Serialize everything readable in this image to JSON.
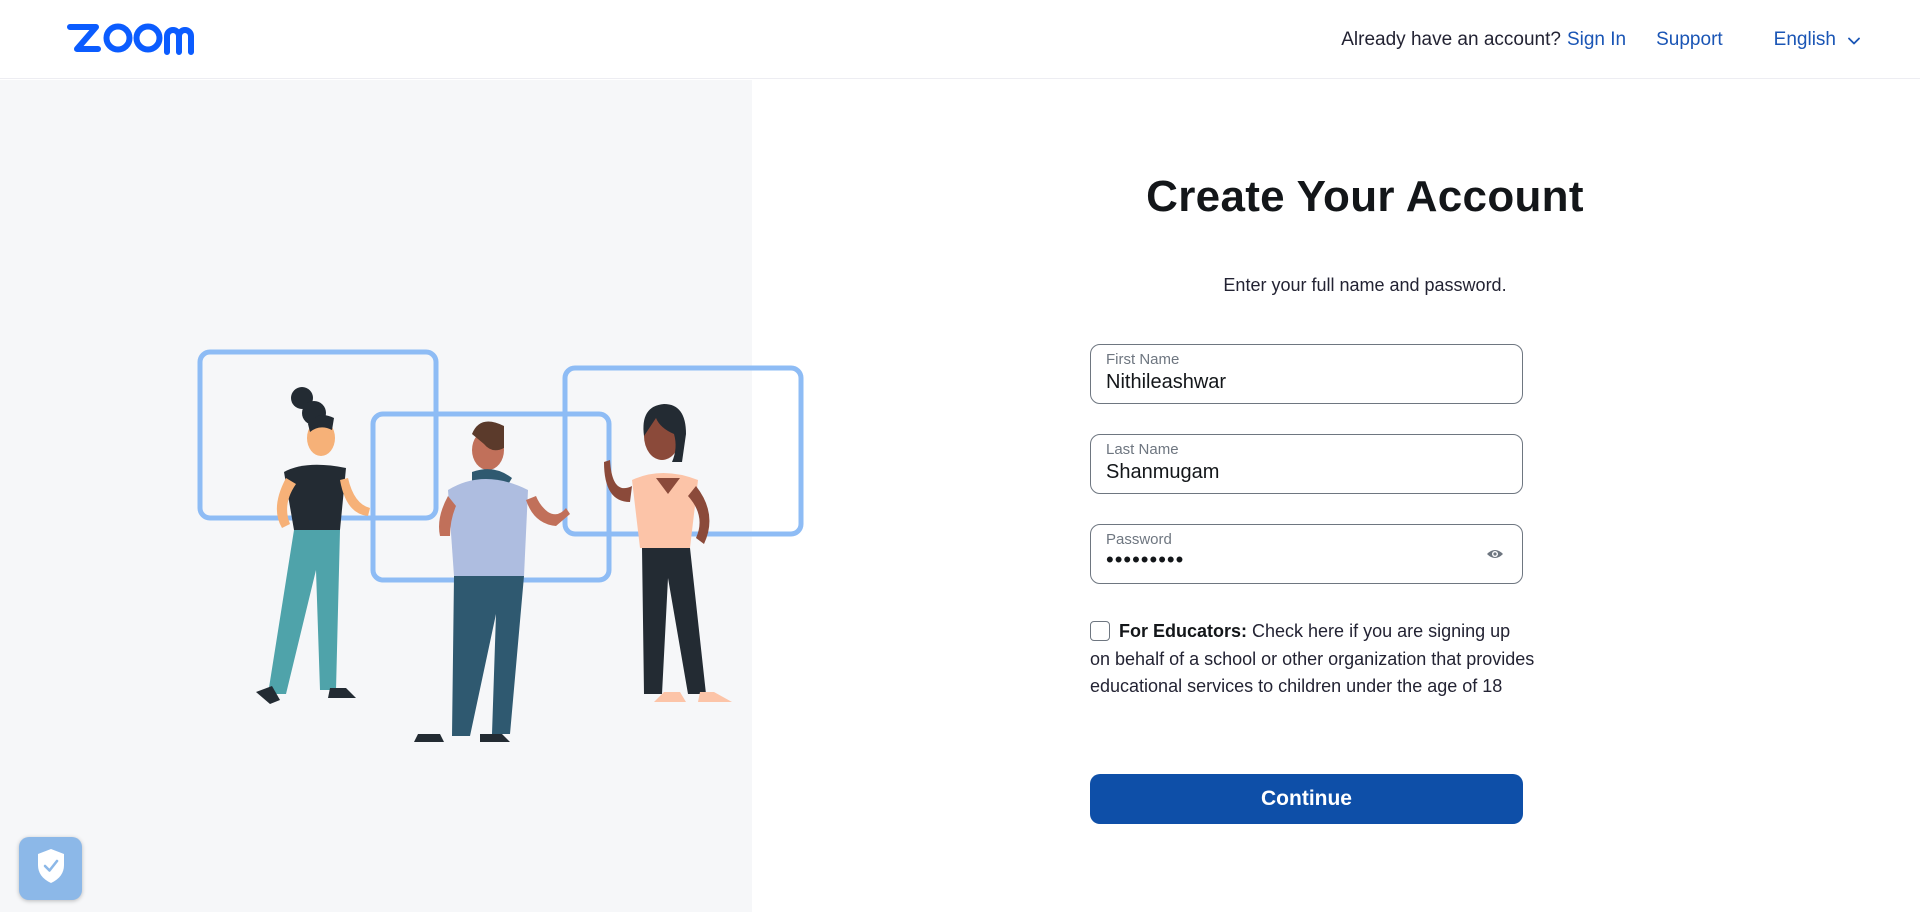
{
  "header": {
    "logo_text": "zoom",
    "account_question": "Already have an account?",
    "sign_in": "Sign In",
    "support": "Support",
    "language": "English"
  },
  "form": {
    "title": "Create Your Account",
    "subtitle": "Enter your full name and password.",
    "first_name": {
      "label": "First Name",
      "value": "Nithileashwar"
    },
    "last_name": {
      "label": "Last Name",
      "value": "Shanmugam"
    },
    "password": {
      "label": "Password",
      "value": "•••••••••"
    },
    "educators": {
      "checked": false,
      "bold": "For Educators:",
      "text": " Check here if you are signing up on behalf of a school or other organization that provides educational services to children under the age of 18"
    },
    "continue": "Continue"
  },
  "icons": {
    "language_chevron": "chevron-down-icon",
    "password_toggle": "eye-icon",
    "privacy_widget": "shield-check-icon"
  },
  "colors": {
    "brand": "#0b5cff",
    "link": "#1a55b5",
    "button": "#0e4fa8",
    "left_panel_bg": "#f6f7f9",
    "frame_blue": "#8ebcf5"
  }
}
